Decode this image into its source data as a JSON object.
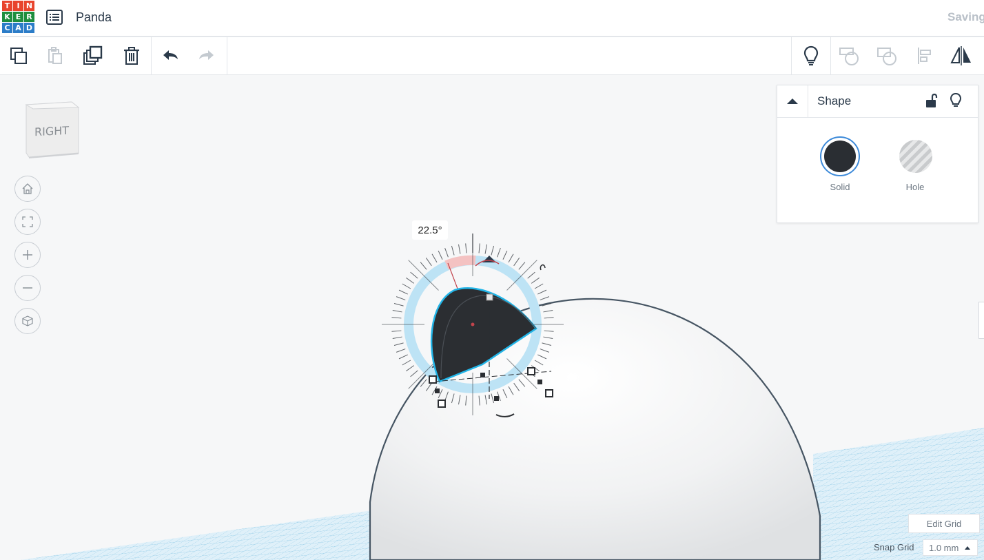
{
  "header": {
    "logo_letters": [
      "T",
      "I",
      "N",
      "K",
      "E",
      "R",
      "C",
      "A",
      "D"
    ],
    "logo_colors": [
      "#e8442d",
      "#e8442d",
      "#e8442d",
      "#1e8e3e",
      "#1e8e3e",
      "#1e8e3e",
      "#2c7dc8",
      "#2c7dc8",
      "#2c7dc8"
    ],
    "project_name": "Panda",
    "status": "Saving"
  },
  "toolbar": {
    "left_icons": [
      "copy-icon",
      "paste-icon",
      "duplicate-icon",
      "delete-icon",
      "undo-icon",
      "redo-icon"
    ],
    "right_icons": [
      "lightbulb-icon",
      "group-icon",
      "ungroup-icon",
      "align-icon",
      "mirror-icon"
    ]
  },
  "viewport": {
    "viewcube_face": "RIGHT",
    "nav_buttons": [
      "home-view",
      "fit-all",
      "zoom-in",
      "zoom-out",
      "perspective-toggle"
    ],
    "rotation_angle": "22.5°"
  },
  "shape_panel": {
    "title": "Shape",
    "solid_label": "Solid",
    "hole_label": "Hole",
    "solid_color": "#2a2e33",
    "selected": "Solid"
  },
  "grid": {
    "edit_label": "Edit Grid",
    "snap_label": "Snap Grid",
    "snap_value": "1.0 mm"
  },
  "colors": {
    "accent": "#3d8ad9",
    "grid_blue": "#8ec9e6",
    "rotate_ring": "#bde3f5"
  }
}
